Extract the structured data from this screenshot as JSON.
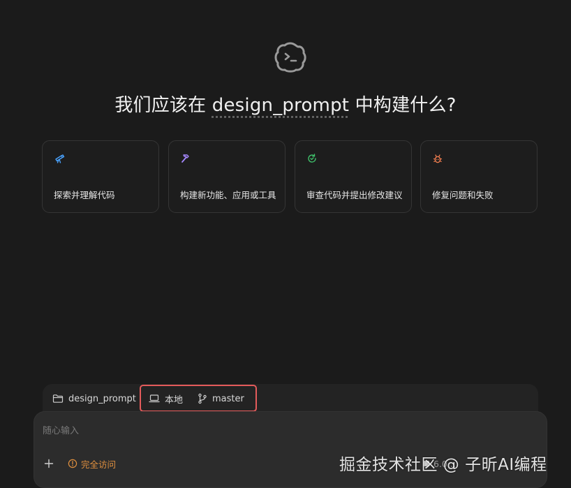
{
  "hero": {
    "prefix": "我们应该在 ",
    "repo": "design_prompt",
    "suffix": " 中构建什么?"
  },
  "cards": [
    {
      "label": "探索并理解代码",
      "icon": "telescope-icon",
      "color": "#4aa3ff"
    },
    {
      "label": "构建新功能、应用或工具",
      "icon": "hammer-icon",
      "color": "#a688ff"
    },
    {
      "label": "审查代码并提出修改建议",
      "icon": "review-refresh-icon",
      "color": "#3fbf6a"
    },
    {
      "label": "修复问题和失败",
      "icon": "bug-icon",
      "color": "#f07d4f"
    }
  ],
  "context_bar": {
    "folder": "design_prompt",
    "environment": "本地",
    "branch": "master"
  },
  "composer": {
    "placeholder": "随心输入",
    "access_label": "完全访问",
    "model_label": "6.0..."
  },
  "watermark": "掘金技术社区 @ 子昕AI编程",
  "colors": {
    "background": "#1b1b1b",
    "accent_red": "#e45b5b",
    "access_orange": "#e0903f"
  }
}
